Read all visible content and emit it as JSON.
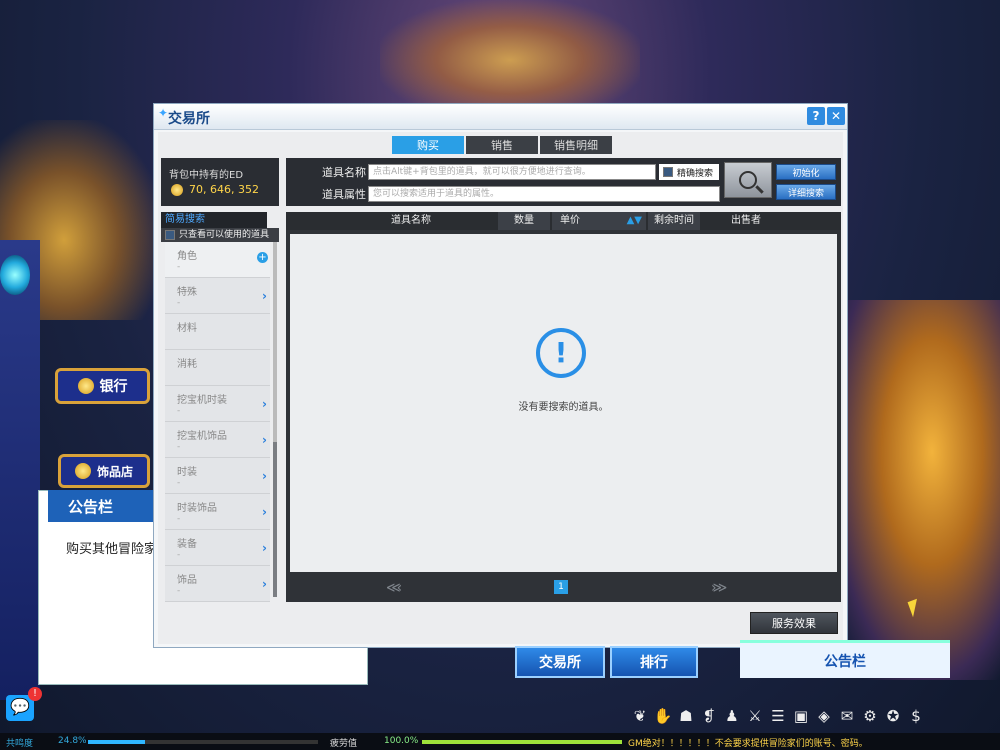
{
  "background": {
    "sign_bank": "银行",
    "sign_shop": "饰品店"
  },
  "notice": {
    "title": "公告栏",
    "text": "购买其他冒险家"
  },
  "window": {
    "title": "交易所",
    "help_label": "?",
    "close_label": "✕",
    "tabs": [
      "购买",
      "销售",
      "销售明细"
    ],
    "money_label": "背包中持有的ED",
    "money_value": "70, 646, 352",
    "search": {
      "name_label": "道具名称",
      "name_placeholder": "点击Alt键+背包里的道具，就可以很方便地进行查询。",
      "exact_label": "精确搜索",
      "attr_label": "道具属性",
      "attr_placeholder": "您可以搜索适用于道具的属性。",
      "init_button": "初始化",
      "detail_button": "详细搜索"
    },
    "category": {
      "header": "简易搜索",
      "usable_only": "只查看可以使用的道具",
      "items": [
        {
          "name": "角色",
          "sub": "-",
          "icon": "plus"
        },
        {
          "name": "特殊",
          "sub": "-",
          "icon": "arrow"
        },
        {
          "name": "材料",
          "sub": "",
          "icon": ""
        },
        {
          "name": "消耗",
          "sub": "",
          "icon": ""
        },
        {
          "name": "挖宝机时装",
          "sub": "-",
          "icon": "arrow"
        },
        {
          "name": "挖宝机饰品",
          "sub": "-",
          "icon": "arrow"
        },
        {
          "name": "时装",
          "sub": "-",
          "icon": "arrow"
        },
        {
          "name": "时装饰品",
          "sub": "-",
          "icon": "arrow"
        },
        {
          "name": "装备",
          "sub": "-",
          "icon": "arrow"
        },
        {
          "name": "饰品",
          "sub": "-",
          "icon": "arrow"
        }
      ]
    },
    "results": {
      "columns": [
        "道具名称",
        "数量",
        "单价",
        "剩余时间",
        "出售者"
      ],
      "sort_icon": "▲▼",
      "empty_text": "没有要搜索的道具。",
      "page": "1",
      "prev_icon": "≪‹",
      "next_icon": "›≫"
    },
    "service_button": "服务效果"
  },
  "bottom_buttons": [
    "交易所",
    "排行",
    "公告栏"
  ],
  "status": {
    "resonance_label": "共鸣度",
    "resonance_value": "24.8%",
    "resonance_fraction": 0.248,
    "fatigue_label": "疲劳值",
    "fatigue_value": "100.0%",
    "fatigue_fraction": 1.0,
    "message": "GM绝对！！！！！！不会要求提供冒险家们的账号、密码。"
  },
  "tray_icons": [
    "wind-icon",
    "pet-icon",
    "bag-icon",
    "book-icon",
    "character-icon",
    "sword-icon",
    "list-icon",
    "box-icon",
    "guild-icon",
    "chat-icon",
    "settings-icon",
    "shop-icon",
    "cash-icon"
  ],
  "colors": {
    "accent": "#2a9fe6",
    "money": "#ffd54a"
  }
}
